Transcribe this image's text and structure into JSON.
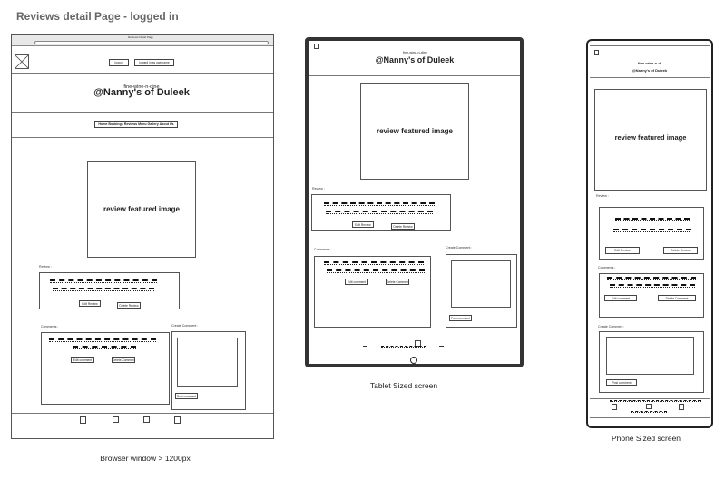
{
  "page_title": "Reviews detail Page -  logged in",
  "captions": {
    "browser": "Browser window > 1200px",
    "tablet": "Tablet Sized screen",
    "phone": "Phone Sized screen"
  },
  "browser": {
    "address_bar": "Reviews Detail Page",
    "header_buttons": [
      "logout",
      "logged in as username"
    ],
    "tagline": "fine-wine-n-dine",
    "brand": "@Nanny's of Duleek",
    "nav": "Home  Bookings  Reviews  Menu  Gallery  About Us",
    "image_label": "review featured image",
    "review_label": "Review :",
    "review_buttons": [
      "Edit Review",
      "Delete Review"
    ],
    "comments_label": "Comments :",
    "comment_buttons": [
      "Edit comment",
      "Delete Comment"
    ],
    "create_comment_label": "Create Comment :",
    "post_button": "Post comment"
  },
  "tablet": {
    "tagline": "fine-wine-n-dine",
    "brand": "@Nanny's of Duleek",
    "image_label": "review featured image",
    "review_label": "Review :",
    "review_buttons": [
      "Edit Review",
      "Delete Review"
    ],
    "comments_label": "Comments :",
    "comment_buttons": [
      "Edit comment",
      "Delete Comment"
    ],
    "create_comment_label": "Create Comment :",
    "post_button": "Post comment"
  },
  "phone": {
    "tagline": "fine-wine-n-di",
    "brand": "@Nanny's of Duleek",
    "image_label": "review featured image",
    "review_label": "Review :",
    "review_buttons": [
      "Edit Review",
      "Delete Review"
    ],
    "comments_label": "Comments :",
    "comment_buttons": [
      "Edit comment",
      "Delete Comment"
    ],
    "create_comment_label": "Create Comment :",
    "post_button": "Post comment"
  }
}
